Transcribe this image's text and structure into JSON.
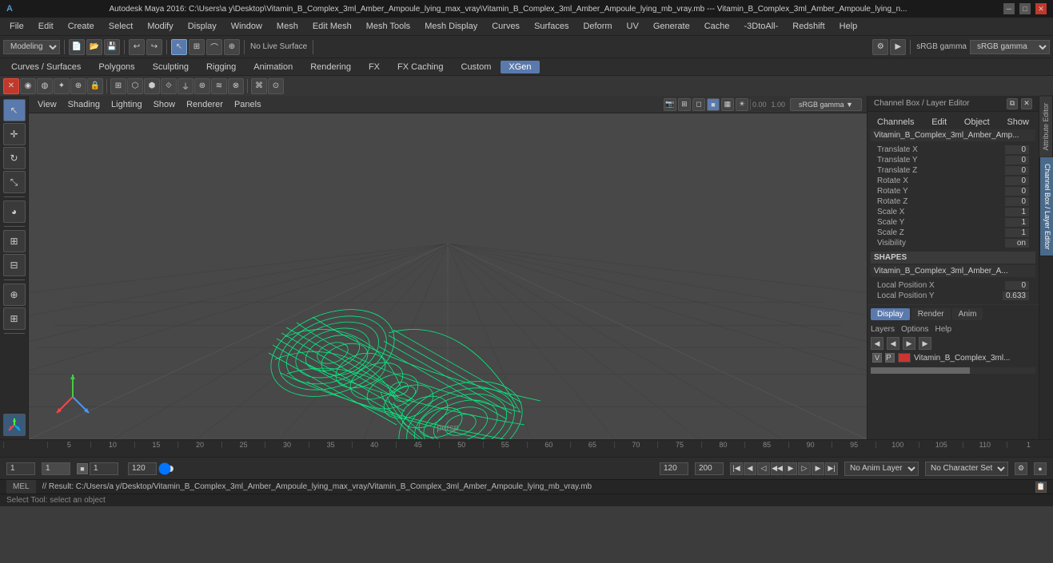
{
  "titleBar": {
    "text": "Autodesk Maya 2016: C:\\Users\\a y\\Desktop\\Vitamin_B_Complex_3ml_Amber_Ampoule_lying_max_vray\\Vitamin_B_Complex_3ml_Amber_Ampoule_lying_mb_vray.mb --- Vitamin_B_Complex_3ml_Amber_Ampoule_lying_n...",
    "winButtons": [
      "─",
      "□",
      "✕"
    ]
  },
  "menuBar": {
    "items": [
      "File",
      "Edit",
      "Create",
      "Select",
      "Modify",
      "Display",
      "Window",
      "Mesh",
      "Edit Mesh",
      "Mesh Tools",
      "Mesh Display",
      "Curves",
      "Surfaces",
      "Deform",
      "UV",
      "Generate",
      "Cache",
      "-3DtoAll-",
      "Redshift",
      "Help"
    ]
  },
  "toolbar1": {
    "workspace": "Modeling",
    "noLiveLabel": "No Live Surface"
  },
  "toolbar2": {
    "tabs": [
      "Curves / Surfaces",
      "Polygons",
      "Sculpting",
      "Rigging",
      "Animation",
      "Rendering",
      "FX",
      "FX Caching",
      "Custom",
      "XGen"
    ]
  },
  "viewportToolbar": {
    "items": [
      "View",
      "Shading",
      "Lighting",
      "Show",
      "Renderer",
      "Panels"
    ]
  },
  "viewport": {
    "perspLabel": "persp"
  },
  "channelBox": {
    "headerTitle": "Channel Box / Layer Editor",
    "menuItems": [
      "Channels",
      "Edit",
      "Object",
      "Show"
    ],
    "objectName": "Vitamin_B_Complex_3ml_Amber_Amp...",
    "translateLabel": "Translate",
    "attributes": [
      {
        "label": "Translate X",
        "value": "0"
      },
      {
        "label": "Translate Y",
        "value": "0"
      },
      {
        "label": "Translate Z",
        "value": "0"
      },
      {
        "label": "Rotate X",
        "value": "0"
      },
      {
        "label": "Rotate Y",
        "value": "0"
      },
      {
        "label": "Rotate Z",
        "value": "0"
      },
      {
        "label": "Scale X",
        "value": "1"
      },
      {
        "label": "Scale Y",
        "value": "1"
      },
      {
        "label": "Scale Z",
        "value": "1"
      },
      {
        "label": "Visibility",
        "value": "on"
      }
    ],
    "shapesSection": "SHAPES",
    "shapeName": "Vitamin_B_Complex_3ml_Amber_A...",
    "shapeAttributes": [
      {
        "label": "Local Position X",
        "value": "0"
      },
      {
        "label": "Local Position Y",
        "value": "0.633"
      }
    ],
    "layerTabs": [
      "Display",
      "Render",
      "Anim"
    ],
    "layerMenus": [
      "Layers",
      "Options",
      "Help"
    ],
    "layerRow": {
      "v": "V",
      "p": "P",
      "name": "Vitamin_B_Complex_3ml..."
    }
  },
  "timeline": {
    "markers": [
      "",
      "5",
      "10",
      "15",
      "20",
      "25",
      "30",
      "35",
      "40",
      "45",
      "50",
      "55",
      "60",
      "65",
      "70",
      "75",
      "80",
      "85",
      "90",
      "95",
      "100",
      "105",
      "110",
      "1"
    ]
  },
  "bottomControls": {
    "frame1": "1",
    "frame2": "1",
    "frame3": "120",
    "endFrame": "120",
    "maxFrame": "200",
    "noAnimLayer": "No Anim Layer",
    "noCharSet": "No Character Set"
  },
  "statusBar": {
    "mode": "MEL",
    "result": "// Result: C:/Users/a y/Desktop/Vitamin_B_Complex_3ml_Amber_Ampoule_lying_max_vray/Vitamin_B_Complex_3ml_Amber_Ampoule_lying_mb_vray.mb",
    "selectTool": "Select Tool: select an object"
  },
  "sidePanel": {
    "attrEditorLabel": "Attribute Editor",
    "channelBoxLabel": "Channel Box / Layer Editor"
  },
  "icons": {
    "select": "↖",
    "move": "✛",
    "rotate": "↻",
    "scale": "⤡",
    "camera": "📷",
    "close": "✕",
    "minimize": "─",
    "maximize": "□"
  }
}
